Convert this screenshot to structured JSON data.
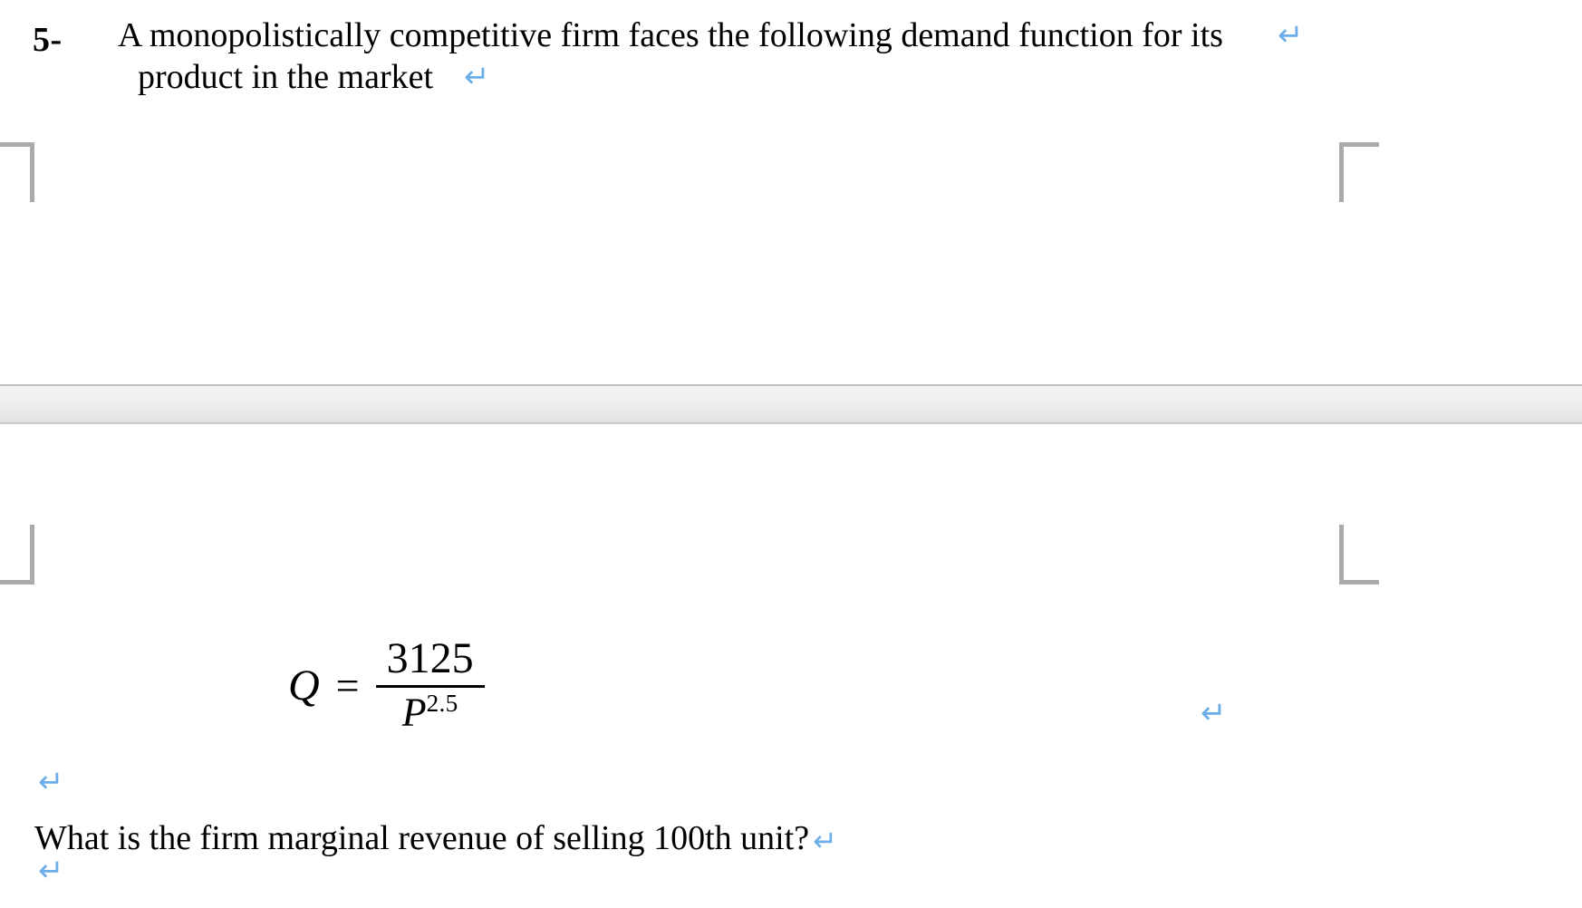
{
  "document": {
    "type": "word-processor-page",
    "background_color": "#ffffff",
    "text_color": "#000000",
    "formatting_mark_color": "#6BAEEA",
    "boundary_marker_color": "#aaaaaa",
    "page_gap_color": "#e9e9e9"
  },
  "question": {
    "number": "5-",
    "line1": "A monopolistically competitive firm faces the following demand function for its",
    "line2": "product in    the market"
  },
  "equation": {
    "left_side": "Q",
    "relation": "=",
    "numerator": "3125",
    "denominator_base": "P",
    "denominator_exponent": "2.5",
    "plain_text": "Q = 3125 / P^2.5"
  },
  "closing": {
    "text": "What is the firm marginal revenue of selling 100th unit?"
  },
  "formatting_marks": {
    "glyph": "↵",
    "marks": [
      {
        "id": "mark-line1-end",
        "label": "paragraph-return-after-line1"
      },
      {
        "id": "mark-line2-end",
        "label": "paragraph-return-after-line2"
      },
      {
        "id": "mark-equation-end",
        "label": "paragraph-return-after-equation"
      },
      {
        "id": "mark-empty-line",
        "label": "paragraph-return-empty-line"
      },
      {
        "id": "mark-closing-end",
        "label": "paragraph-return-after-closing"
      },
      {
        "id": "mark-trailing",
        "label": "paragraph-return-trailing"
      }
    ]
  },
  "boundary_markers": {
    "top_left": "text-boundary-corner-top-left",
    "top_right": "text-boundary-corner-top-right",
    "bottom_left": "text-boundary-corner-bottom-left",
    "bottom_right": "text-boundary-corner-bottom-right"
  }
}
